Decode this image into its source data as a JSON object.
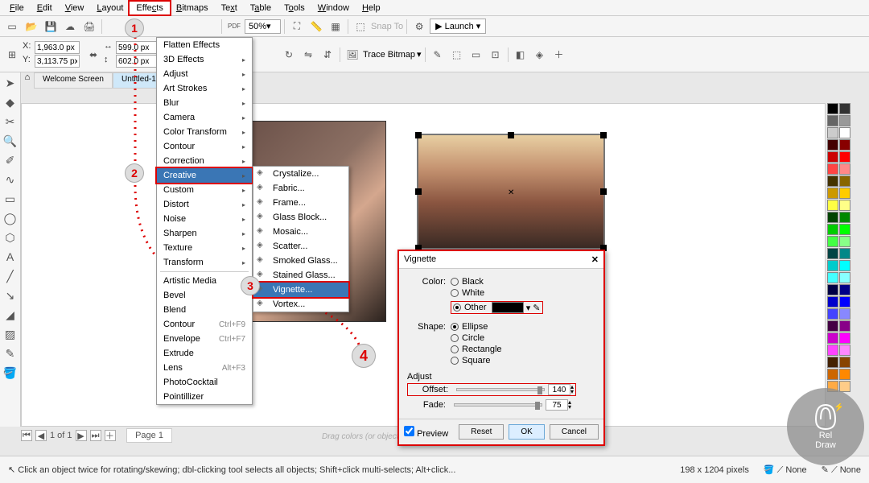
{
  "menu": {
    "file": "File",
    "edit": "Edit",
    "view": "View",
    "layout": "Layout",
    "effects": "Effects",
    "bitmaps": "Bitmaps",
    "text": "Text",
    "table": "Table",
    "tools": "Tools",
    "window": "Window",
    "help": "Help"
  },
  "toolbar": {
    "zoom": "50%",
    "launch": "Launch",
    "trace": "Trace Bitmap",
    "snap": "Snap To"
  },
  "pos": {
    "xlabel": "X:",
    "ylabel": "Y:",
    "x": "1,963.0 px",
    "y": "3,113.75 px",
    "w": "599.0 px",
    "h": "602.0 px"
  },
  "tabs": {
    "welcome": "Welcome Screen",
    "untitled": "Untitled-1"
  },
  "effects_menu": [
    "Flatten Effects",
    "3D Effects",
    "Adjust",
    "Art Strokes",
    "Blur",
    "Camera",
    "Color Transform",
    "Contour",
    "Correction",
    "Creative",
    "Custom",
    "Distort",
    "Noise",
    "Sharpen",
    "Texture",
    "Transform",
    "—",
    "Artistic Media",
    "Bevel",
    "Blend",
    "Contour",
    "Envelope",
    "Extrude",
    "Lens",
    "PhotoCocktail",
    "Pointillizer"
  ],
  "effects_shortcuts": {
    "20": "Ctrl+F9",
    "21": "Ctrl+F7",
    "23": "Alt+F3"
  },
  "creative_sub": [
    "Crystalize...",
    "Fabric...",
    "Frame...",
    "Glass Block...",
    "Mosaic...",
    "Scatter...",
    "Smoked Glass...",
    "Stained Glass...",
    "Vignette...",
    "Vortex..."
  ],
  "dialog": {
    "title": "Vignette",
    "color_label": "Color:",
    "black": "Black",
    "white": "White",
    "other": "Other",
    "shape_label": "Shape:",
    "ellipse": "Ellipse",
    "circle": "Circle",
    "rectangle": "Rectangle",
    "square": "Square",
    "adjust": "Adjust",
    "offset": "Offset:",
    "fade": "Fade:",
    "offset_val": "140",
    "fade_val": "75",
    "preview": "Preview",
    "reset": "Reset",
    "ok": "OK",
    "cancel": "Cancel"
  },
  "status": {
    "hint": "Click an object twice for rotating/skewing; dbl-clicking tool selects all objects; Shift+click multi-selects; Alt+click...",
    "drag": "Drag colors (or objects)",
    "size": "198 x 1204 pixels",
    "none": "None"
  },
  "pager": {
    "info": "1 of 1",
    "page": "Page 1"
  },
  "markers": {
    "m1": "1",
    "m2": "2",
    "m3": "3",
    "m4": "4"
  },
  "logo": {
    "l1": "Rel",
    "l2": "Draw"
  },
  "palette_colors": [
    "#000",
    "#333",
    "#666",
    "#999",
    "#ccc",
    "#fff",
    "#400",
    "#800",
    "#c00",
    "#f00",
    "#f44",
    "#f88",
    "#430",
    "#860",
    "#c90",
    "#fc0",
    "#ff4",
    "#ff8",
    "#040",
    "#080",
    "#0c0",
    "#0f0",
    "#4f4",
    "#8f8",
    "#044",
    "#088",
    "#0cc",
    "#0ff",
    "#4ff",
    "#8ff",
    "#004",
    "#008",
    "#00c",
    "#00f",
    "#44f",
    "#88f",
    "#404",
    "#808",
    "#c0c",
    "#f0f",
    "#f4f",
    "#f8f",
    "#420",
    "#840",
    "#c60",
    "#f80",
    "#fa4",
    "#fc8"
  ]
}
